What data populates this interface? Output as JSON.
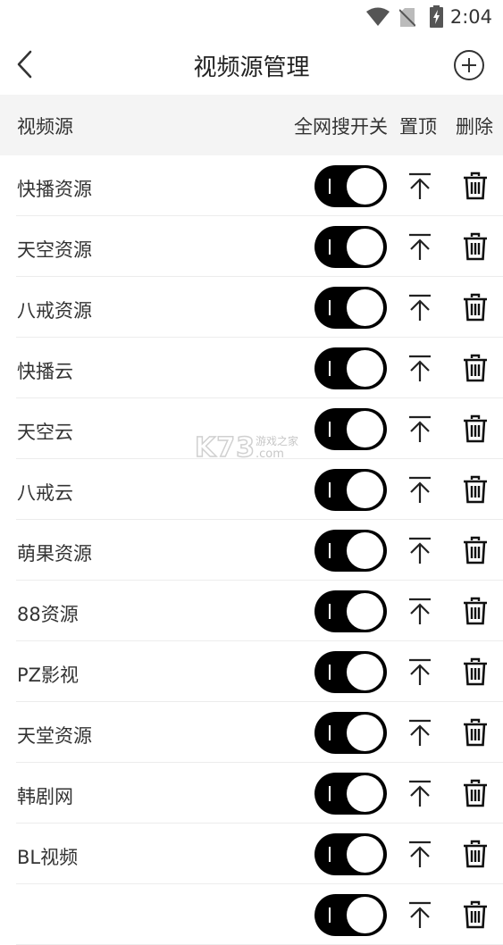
{
  "status_bar": {
    "time": "2:04",
    "icons": [
      "wifi-icon",
      "no-sim-icon",
      "battery-charging-icon"
    ]
  },
  "header": {
    "title": "视频源管理",
    "back_icon": "back-chevron-icon",
    "add_icon": "add-circle-icon"
  },
  "columns": {
    "name": "视频源",
    "global_search": "全网搜开关",
    "pin_top": "置顶",
    "delete": "删除"
  },
  "sources": [
    {
      "name": "快播资源",
      "enabled": true
    },
    {
      "name": "天空资源",
      "enabled": true
    },
    {
      "name": "八戒资源",
      "enabled": true
    },
    {
      "name": "快播云",
      "enabled": true
    },
    {
      "name": "天空云",
      "enabled": true
    },
    {
      "name": "八戒云",
      "enabled": true
    },
    {
      "name": "萌果资源",
      "enabled": true
    },
    {
      "name": "88资源",
      "enabled": true
    },
    {
      "name": "PZ影视",
      "enabled": true
    },
    {
      "name": "天堂资源",
      "enabled": true
    },
    {
      "name": "韩剧网",
      "enabled": true
    },
    {
      "name": "BL视频",
      "enabled": true
    },
    {
      "name": "",
      "enabled": true
    }
  ],
  "watermark": {
    "logo": "K73",
    "cn": "游戏之家",
    "domain": ".com"
  },
  "colors": {
    "toggle_on": "#000000",
    "header_bg": "#f4f4f4",
    "divider": "#ececec"
  }
}
